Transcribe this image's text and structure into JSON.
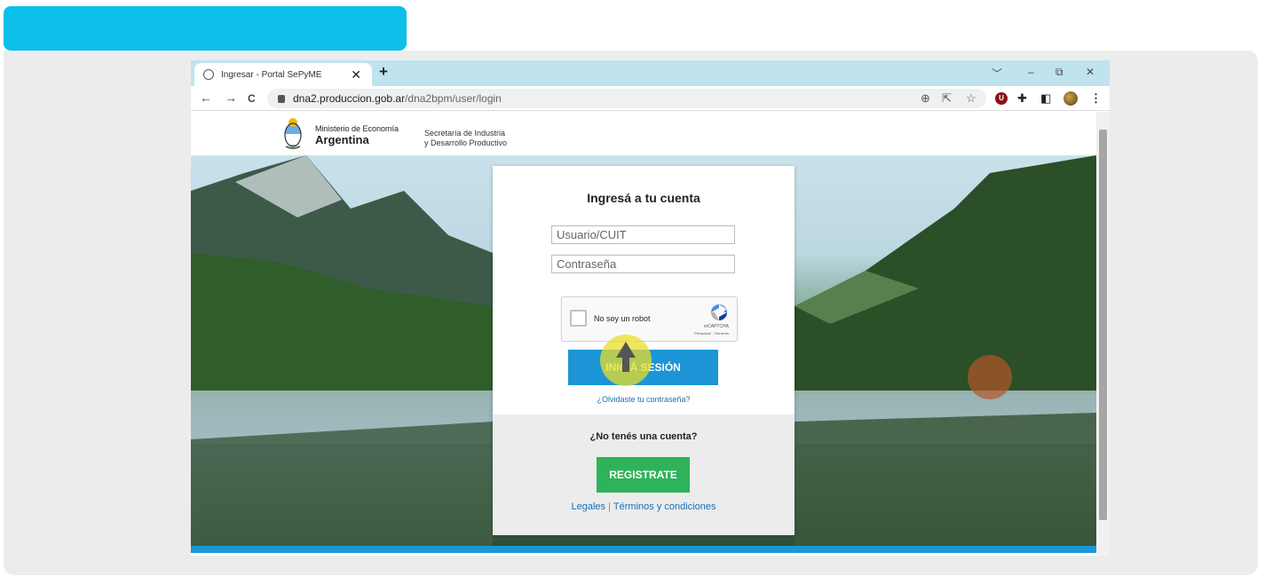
{
  "browser": {
    "tab_title": "Ingresar - Portal SePyME",
    "tab_close": "✕",
    "new_tab": "+",
    "window_controls": {
      "chevron": "﹀",
      "minimize": "–",
      "restore": "⧉",
      "close": "✕"
    },
    "nav": {
      "back": "←",
      "forward": "→",
      "reload": "C"
    },
    "url_host": "dna2.produccion.gob.ar",
    "url_path": "/dna2bpm/user/login",
    "toolbar_icons": {
      "zoom": "⊕",
      "share": "⇱",
      "bookmark": "☆",
      "extension": "U",
      "puzzle": "✚",
      "sidepanel": "◧",
      "menu": "⋮"
    }
  },
  "site_header": {
    "ministry_line1": "Ministerio de Economía",
    "ministry_line2": "Argentina",
    "secretariat_line1": "Secretaría de Industria",
    "secretariat_line2": "y Desarrollo Productivo"
  },
  "login_card": {
    "title": "Ingresá a tu cuenta",
    "username_placeholder": "Usuario/CUIT",
    "password_placeholder": "Contraseña",
    "captcha_label": "No soy un robot",
    "captcha_brand": "reCAPTCHA",
    "captcha_links": "Privacidad - Términos",
    "login_button": "INICIÁ SESIÓN",
    "forgot_link": "¿Olvidaste tu contraseña?",
    "no_account": "¿No tenés una cuenta?",
    "register_button": "REGISTRATE",
    "legal_link": "Legales",
    "link_separator": "|",
    "terms_link": "Términos y condiciones"
  },
  "colors": {
    "accent_cyan": "#0bbfe8",
    "login_blue": "#1b95d5",
    "register_green": "#2fb35a",
    "link_blue": "#1b6fb3"
  }
}
